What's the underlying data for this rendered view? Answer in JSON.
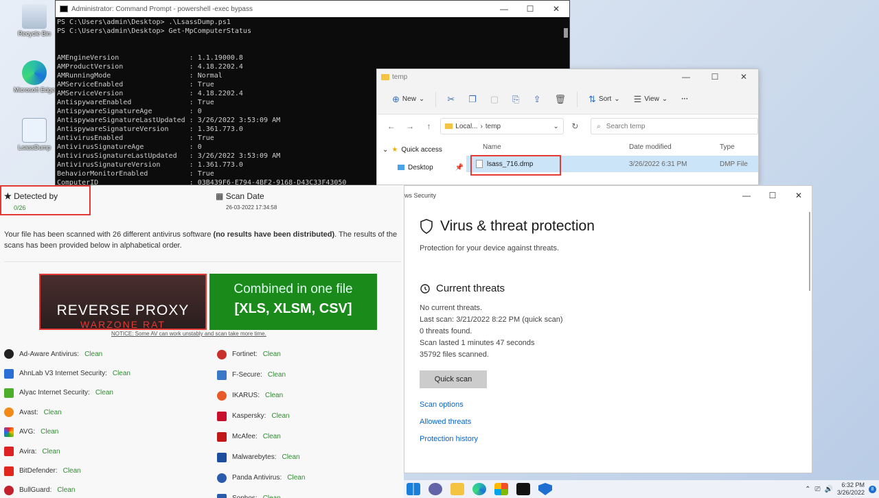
{
  "desktop": {
    "icons": [
      {
        "label": "Recycle Bin",
        "icon": "recycle-bin-icon"
      },
      {
        "label": "Microsoft Edge",
        "icon": "edge-icon"
      },
      {
        "label": "LsassDump",
        "icon": "powershell-script-icon"
      }
    ]
  },
  "cmd": {
    "title": "Administrator: Command Prompt - powershell  -exec bypass",
    "lines": [
      "PS C:\\Users\\admin\\Desktop> .\\LsassDump.ps1",
      "PS C:\\Users\\admin\\Desktop> Get-MpComputerStatus",
      "",
      "",
      "AMEngineVersion                 : 1.1.19000.8",
      "AMProductVersion                : 4.18.2202.4",
      "AMRunningMode                   : Normal",
      "AMServiceEnabled                : True",
      "AMServiceVersion                : 4.18.2202.4",
      "AntispywareEnabled              : True",
      "AntispywareSignatureAge         : 0",
      "AntispywareSignatureLastUpdated : 3/26/2022 3:53:09 AM",
      "AntispywareSignatureVersion     : 1.361.773.0",
      "AntivirusEnabled                : True",
      "AntivirusSignatureAge           : 0",
      "AntivirusSignatureLastUpdated   : 3/26/2022 3:53:09 AM",
      "AntivirusSignatureVersion       : 1.361.773.0",
      "BehaviorMonitorEnabled          : True",
      "ComputerID                      : 03B439F6-E794-4BF2-9168-D43C33F43050"
    ]
  },
  "explorer": {
    "title": "temp",
    "toolbar": {
      "new": "New",
      "sort": "Sort",
      "view": "View",
      "more": "···"
    },
    "address": {
      "segment1": "Local...",
      "sep": "›",
      "segment2": "temp"
    },
    "search_placeholder": "Search temp",
    "nav": {
      "quick_access": "Quick access",
      "desktop": "Desktop"
    },
    "columns": {
      "name": "Name",
      "date": "Date modified",
      "type": "Type"
    },
    "file": {
      "name": "lsass_716.dmp",
      "date": "3/26/2022 6:31 PM",
      "type": "DMP File"
    }
  },
  "scan": {
    "detected_label": "Detected by",
    "detected_value": "0/26",
    "date_label": "Scan Date",
    "date_value": "26-03-2022 17:34:58",
    "desc_part1": "Your file has been scanned with 26 different antivirus software ",
    "desc_bold": "(no results have been distributed)",
    "desc_part2": ". The results of the scans has been provided below in alphabetical order.",
    "banner1_line1": "REVERSE PROXY",
    "banner1_line2": "WARZONE RAT",
    "banner2_line1": "Combined in one file",
    "banner2_line2": "[XLS, XLSM, CSV]",
    "notice": "NOTICE: Some AV can work unstably and scan take more time.",
    "status": "Clean",
    "left": [
      "Ad-Aware Antivirus:",
      "AhnLab V3 Internet Security:",
      "Alyac Internet Security:",
      "Avast:",
      "AVG:",
      "Avira:",
      "BitDefender:",
      "BullGuard:"
    ],
    "right": [
      "Fortinet:",
      "F-Secure:",
      "IKARUS:",
      "Kaspersky:",
      "McAfee:",
      "Malwarebytes:",
      "Panda Antivirus:",
      "Sophos:"
    ]
  },
  "security": {
    "title": "ws Security",
    "heading": "Virus & threat protection",
    "subheading": "Protection for your device against threats.",
    "current_threats": "Current threats",
    "no_threats": "No current threats.",
    "last_scan": "Last scan: 3/21/2022 8:22 PM (quick scan)",
    "found": "0 threats found.",
    "lasted": "Scan lasted 1 minutes 47 seconds",
    "files": "35792 files scanned.",
    "quick_scan": "Quick scan",
    "links": [
      "Scan options",
      "Allowed threats",
      "Protection history"
    ]
  },
  "taskbar": {
    "time": "6:32 PM",
    "date": "3/26/2022",
    "notifications": "8"
  }
}
